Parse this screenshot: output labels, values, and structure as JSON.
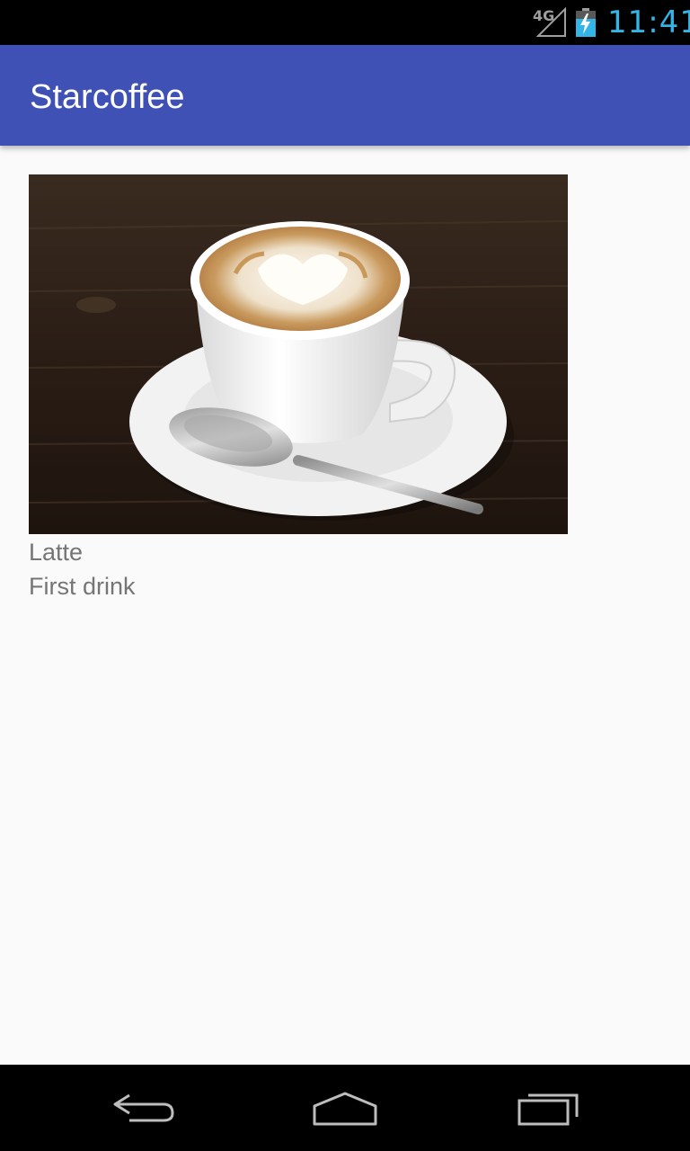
{
  "status_bar": {
    "network": "4G",
    "time": "11:41",
    "icons": [
      "signal-icon",
      "battery-charging-icon"
    ]
  },
  "app_bar": {
    "title": "Starcoffee"
  },
  "drinks": [
    {
      "name": "Latte",
      "description": "First drink",
      "image": "latte-cup-photo"
    }
  ],
  "nav_bar": {
    "icons": [
      "back-icon",
      "home-icon",
      "recents-icon"
    ]
  },
  "colors": {
    "primary": "#3f51b5",
    "status_time": "#33b5e5",
    "secondary_text": "#757575",
    "background": "#fafafa"
  }
}
